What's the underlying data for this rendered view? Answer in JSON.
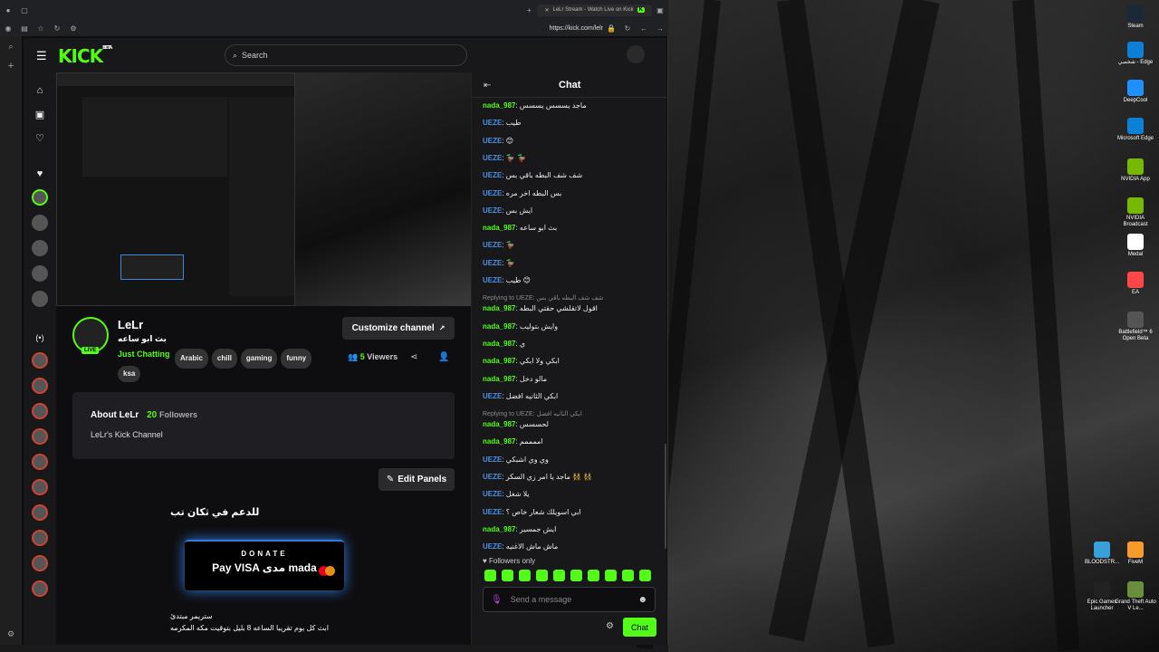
{
  "browser": {
    "tab_title": "LeLr Stream - Watch Live on Kick",
    "url": "https://kick.com/lelr"
  },
  "header": {
    "logo": "KICK",
    "logo_badge": "BETA",
    "search_placeholder": "Search"
  },
  "channel": {
    "name": "LeLr",
    "title": "بث ابو ساعه",
    "category": "Just Chatting",
    "tags": [
      "Arabic",
      "chill",
      "gaming",
      "funny",
      "ksa"
    ],
    "live_label": "LIVE",
    "customize_label": "Customize channel",
    "viewers_count": "5",
    "viewers_label": "Viewers"
  },
  "about": {
    "title": "About LeLr",
    "followers_count": "20",
    "followers_label": "Followers",
    "description": "LeLr's Kick Channel",
    "edit_panels_label": "Edit Panels"
  },
  "panel": {
    "heading": "للدعم في ثكان تب",
    "donate_label": "DONATE",
    "pay_methods": "Pay VISA مدى mada",
    "footer_line1": "ستريمر مبتدئ",
    "footer_line2": "ابث كل يوم تقريبا الساعه 8 بليل بتوقيت مكه المكرمه"
  },
  "chat": {
    "title": "Chat",
    "followers_only": "Followers only",
    "input_placeholder": "Send a message",
    "send_label": "Chat",
    "messages": [
      {
        "user": "nada_987",
        "text": "ماجد يسسس يسسس",
        "color": "#53fc18"
      },
      {
        "user": "UEZE",
        "text": "طيب",
        "color": "#4a90e2"
      },
      {
        "user": "UEZE",
        "text": "😊",
        "color": "#4a90e2"
      },
      {
        "user": "UEZE",
        "text": "🦆 🦆",
        "color": "#4a90e2"
      },
      {
        "user": "UEZE",
        "text": "شف شف البطه باقي بس",
        "color": "#4a90e2"
      },
      {
        "user": "UEZE",
        "text": "بس البطه اخر مره",
        "color": "#4a90e2"
      },
      {
        "user": "UEZE",
        "text": "ايش بس",
        "color": "#4a90e2"
      },
      {
        "user": "nada_987",
        "text": "بث ابو ساعه",
        "color": "#53fc18"
      },
      {
        "user": "UEZE",
        "text": "🦆",
        "color": "#4a90e2"
      },
      {
        "user": "UEZE",
        "text": "🦆",
        "color": "#4a90e2"
      },
      {
        "user": "UEZE",
        "text": "طيب 😊",
        "color": "#4a90e2"
      },
      {
        "user": "nada_987",
        "text": "اقول لاتقلشي حقتي البطه",
        "color": "#53fc18",
        "reply": "Replying to UEZE: شف شف البطه باقي بس"
      },
      {
        "user": "nada_987",
        "text": "وايش بتوليب",
        "color": "#53fc18"
      },
      {
        "user": "nada_987",
        "text": "ي",
        "color": "#53fc18"
      },
      {
        "user": "nada_987",
        "text": "ابكي ولا ابكي",
        "color": "#53fc18"
      },
      {
        "user": "nada_987",
        "text": "مالو دخل",
        "color": "#53fc18"
      },
      {
        "user": "UEZE",
        "text": "ابكي الثانيه افضل",
        "color": "#4a90e2"
      },
      {
        "user": "nada_987",
        "text": "لحسسس",
        "color": "#53fc18",
        "reply": "Replying to UEZE: ابكي الثانيه افضل"
      },
      {
        "user": "nada_987",
        "text": "اممممم",
        "color": "#53fc18"
      },
      {
        "user": "UEZE",
        "text": "وي وي اشبكي",
        "color": "#4a90e2"
      },
      {
        "user": "UEZE",
        "text": "ماجد يا امر زي السكر 👯 👯",
        "color": "#4a90e2"
      },
      {
        "user": "UEZE",
        "text": "يلا شغل",
        "color": "#4a90e2"
      },
      {
        "user": "UEZE",
        "text": "ابي اسويلك شعار خاص ؟",
        "color": "#4a90e2"
      },
      {
        "user": "nada_987",
        "text": "ايش جمسير",
        "color": "#53fc18"
      },
      {
        "user": "UEZE",
        "text": "ماش ماش الاغنيه",
        "color": "#4a90e2"
      }
    ]
  },
  "desktop_icons": [
    {
      "label": "Steam",
      "color": "#1b2838"
    },
    {
      "label": "شخصي - Edge",
      "color": "#0c7fd6"
    },
    {
      "label": "DeepCool",
      "color": "#1e90ff"
    },
    {
      "label": "Microsoft Edge",
      "color": "#0c7fd6"
    },
    {
      "label": "NVIDIA App",
      "color": "#76b900"
    },
    {
      "label": "NVIDIA Broadcast",
      "color": "#76b900"
    },
    {
      "label": "Medal",
      "color": "#ffffff"
    },
    {
      "label": "EA",
      "color": "#ff4747"
    },
    {
      "label": "Battlefield™ 6 Open Beta",
      "color": "#555555"
    },
    {
      "label": "BLOODSTR...",
      "color": "#3aa0d9"
    },
    {
      "label": "FiveM",
      "color": "#f79b2a"
    },
    {
      "label": "Epic Games Launcher",
      "color": "#222222"
    },
    {
      "label": "Grand Theft Auto V Le...",
      "color": "#6a8f3a"
    }
  ],
  "colors": {
    "accent": "#53fc18",
    "background": "#0e0e10",
    "panel": "#18181b",
    "user_blue": "#4a90e2"
  }
}
